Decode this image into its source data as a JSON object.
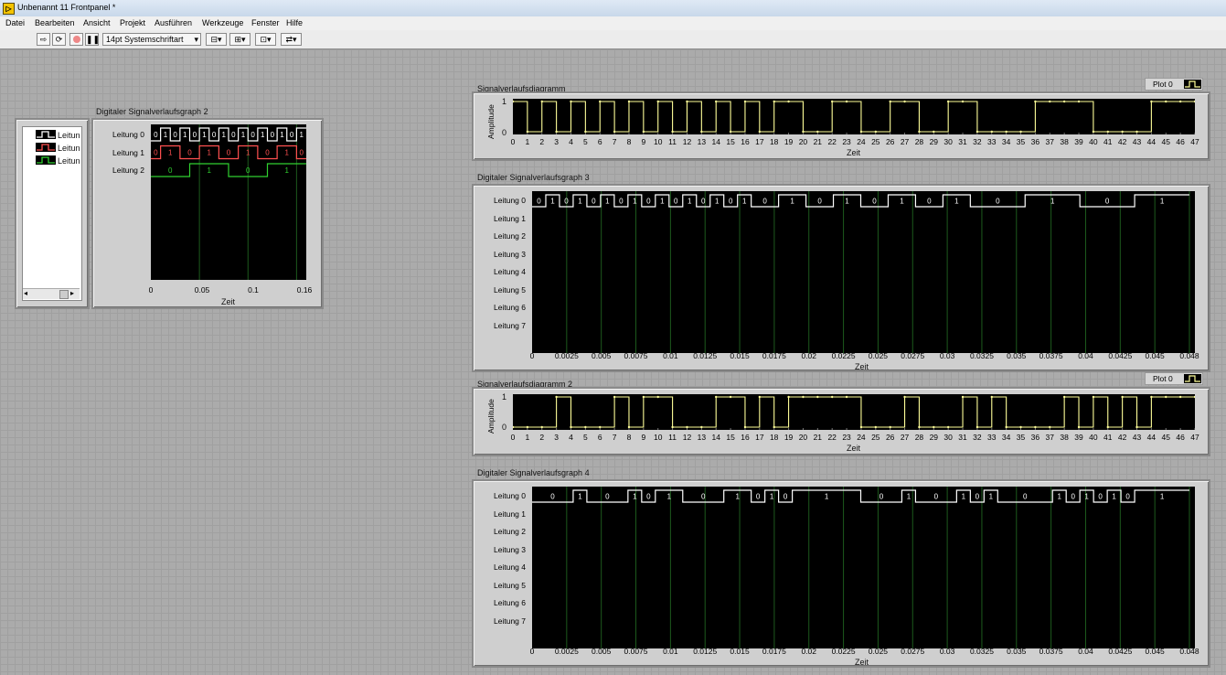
{
  "window": {
    "title": "Unbenannt 11 Frontpanel *"
  },
  "menu": [
    "Datei",
    "Bearbeiten",
    "Ansicht",
    "Projekt",
    "Ausführen",
    "Werkzeuge",
    "Fenster",
    "Hilfe"
  ],
  "toolbar": {
    "font": "14pt Systemschriftart"
  },
  "colors": {
    "accent_white": "#ffffff",
    "accent_red": "#ff5050",
    "accent_green": "#30d030",
    "accent_yellow": "#ffff99",
    "grid": "#1d5a1d"
  },
  "dg2": {
    "title": "Digitaler Signalverlaufsgraph 2",
    "legend": [
      "Leitun",
      "Leitun",
      "Leitun"
    ],
    "channels": [
      "Leitung 0",
      "Leitung 1",
      "Leitung 2"
    ],
    "ticks": [
      "0",
      "0.05",
      "0.1",
      "0.16"
    ],
    "xlabel": "Zeit",
    "rows": [
      {
        "color": "white",
        "states": [
          "0",
          "1",
          "0",
          "1",
          "0",
          "1",
          "0",
          "1",
          "0",
          "1",
          "0",
          "1",
          "0",
          "1",
          "0",
          "1"
        ]
      },
      {
        "color": "red",
        "states": [
          "0",
          "1",
          "1",
          "0",
          "0",
          "1",
          "1",
          "0",
          "0",
          "1",
          "1",
          "0",
          "0",
          "1",
          "1",
          "0"
        ]
      },
      {
        "color": "green",
        "states": [
          "0",
          "0",
          "0",
          "0",
          "1",
          "1",
          "1",
          "1",
          "0",
          "0",
          "0",
          "0",
          "1",
          "1",
          "1",
          "1"
        ]
      }
    ]
  },
  "wf1": {
    "title": "Signalverlaufsdiagramm",
    "plot_label": "Plot 0",
    "ylabel": "Amplitude",
    "yticks": [
      "1",
      "0"
    ],
    "xticks": [
      "0",
      "1",
      "2",
      "3",
      "4",
      "5",
      "6",
      "7",
      "8",
      "9",
      "10",
      "11",
      "12",
      "13",
      "14",
      "15",
      "16",
      "17",
      "18",
      "19",
      "20",
      "21",
      "22",
      "23",
      "24",
      "25",
      "26",
      "27",
      "28",
      "29",
      "30",
      "31",
      "32",
      "33",
      "34",
      "35",
      "36",
      "37",
      "38",
      "39",
      "40",
      "41",
      "42",
      "43",
      "44",
      "45",
      "46",
      "47"
    ],
    "xlabel": "Zeit",
    "values": [
      1,
      0,
      1,
      0,
      1,
      0,
      1,
      0,
      1,
      0,
      1,
      0,
      1,
      0,
      1,
      0,
      1,
      0,
      1,
      1,
      0,
      0,
      1,
      1,
      0,
      0,
      1,
      1,
      0,
      0,
      1,
      1,
      0,
      0,
      0,
      0,
      1,
      1,
      1,
      1,
      0,
      0,
      0,
      0,
      1,
      1,
      1,
      1
    ]
  },
  "dg3": {
    "title": "Digitaler Signalverlaufsgraph 3",
    "channels": [
      "Leitung 0",
      "Leitung 1",
      "Leitung 2",
      "Leitung 3",
      "Leitung 4",
      "Leitung 5",
      "Leitung 6",
      "Leitung 7"
    ],
    "ticks": [
      "0",
      "0.0025",
      "0.005",
      "0.0075",
      "0.01",
      "0.0125",
      "0.015",
      "0.0175",
      "0.02",
      "0.0225",
      "0.025",
      "0.0275",
      "0.03",
      "0.0325",
      "0.035",
      "0.0375",
      "0.04",
      "0.0425",
      "0.045",
      "0.048"
    ],
    "xlabel": "Zeit",
    "states": [
      "0",
      "1",
      "0",
      "1",
      "0",
      "1",
      "0",
      "1",
      "0",
      "1",
      "0",
      "1",
      "0",
      "1",
      "0",
      "1",
      "0",
      "0",
      "1",
      "1",
      "0",
      "0",
      "1",
      "1",
      "0",
      "0",
      "1",
      "1",
      "0",
      "0",
      "1",
      "1",
      "0",
      "0",
      "0",
      "0",
      "1",
      "1",
      "1",
      "1",
      "0",
      "0",
      "0",
      "0",
      "1",
      "1",
      "1",
      "1"
    ]
  },
  "wf2": {
    "title": "Signalverlaufsdiagramm 2",
    "plot_label": "Plot 0",
    "ylabel": "Amplitude",
    "yticks": [
      "1",
      "0"
    ],
    "xticks": [
      "0",
      "1",
      "2",
      "3",
      "4",
      "5",
      "6",
      "7",
      "8",
      "9",
      "10",
      "11",
      "12",
      "13",
      "14",
      "15",
      "16",
      "17",
      "18",
      "19",
      "20",
      "21",
      "22",
      "23",
      "24",
      "25",
      "26",
      "27",
      "28",
      "29",
      "30",
      "31",
      "32",
      "33",
      "34",
      "35",
      "36",
      "37",
      "38",
      "39",
      "40",
      "41",
      "42",
      "43",
      "44",
      "45",
      "46",
      "47"
    ],
    "xlabel": "Zeit",
    "values": [
      0,
      0,
      0,
      1,
      0,
      0,
      0,
      1,
      0,
      1,
      1,
      0,
      0,
      0,
      1,
      1,
      0,
      1,
      0,
      1,
      1,
      1,
      1,
      1,
      0,
      0,
      0,
      1,
      0,
      0,
      0,
      1,
      0,
      1,
      0,
      0,
      0,
      0,
      1,
      0,
      1,
      0,
      1,
      0,
      1,
      1,
      1,
      1
    ]
  },
  "dg4": {
    "title": "Digitaler Signalverlaufsgraph 4",
    "channels": [
      "Leitung 0",
      "Leitung 1",
      "Leitung 2",
      "Leitung 3",
      "Leitung 4",
      "Leitung 5",
      "Leitung 6",
      "Leitung 7"
    ],
    "ticks": [
      "0",
      "0.0025",
      "0.005",
      "0.0075",
      "0.01",
      "0.0125",
      "0.015",
      "0.0175",
      "0.02",
      "0.0225",
      "0.025",
      "0.0275",
      "0.03",
      "0.0325",
      "0.035",
      "0.0375",
      "0.04",
      "0.0425",
      "0.045",
      "0.048"
    ],
    "xlabel": "Zeit",
    "states": [
      "0",
      "0",
      "0",
      "1",
      "0",
      "0",
      "0",
      "1",
      "0",
      "1",
      "1",
      "0",
      "0",
      "0",
      "1",
      "1",
      "0",
      "1",
      "0",
      "1",
      "1",
      "1",
      "1",
      "1",
      "0",
      "0",
      "0",
      "1",
      "0",
      "0",
      "0",
      "1",
      "0",
      "1",
      "0",
      "0",
      "0",
      "0",
      "1",
      "0",
      "1",
      "0",
      "1",
      "0",
      "1",
      "1",
      "1",
      "1"
    ]
  }
}
